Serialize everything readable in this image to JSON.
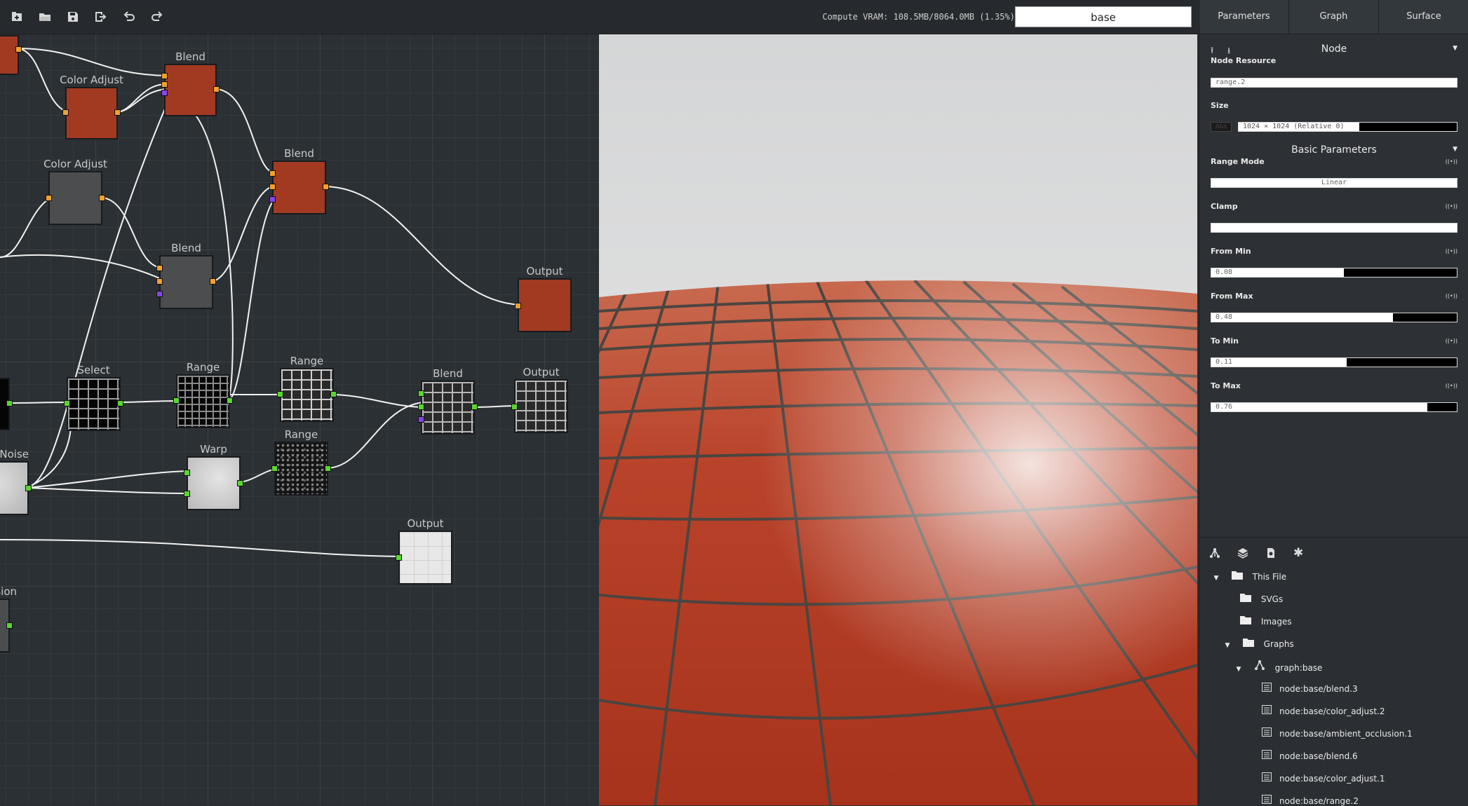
{
  "toolbar": {
    "buttons": [
      "new-file-icon",
      "open-folder-icon",
      "save-icon",
      "export-icon",
      "undo-icon",
      "redo-icon"
    ],
    "vram": "Compute VRAM: 108.5MB/8064.0MB (1.35%)",
    "graph_name": "base"
  },
  "graph": {
    "nodes": {
      "blend_a": "Blend",
      "color_adjust_a": "Color Adjust",
      "color_adjust_b": "Color Adjust",
      "blend_b": "Blend",
      "blend_c": "Blend",
      "output_a": "Output",
      "select": "Select",
      "range_a": "Range",
      "range_b": "Range",
      "blend_d": "Blend",
      "output_b": "Output",
      "noise": "Noise",
      "warp": "Warp",
      "range_c": "Range",
      "output_c": "Output",
      "occlusion": "lusion"
    }
  },
  "panel": {
    "tabs": [
      "Parameters",
      "Graph",
      "Surface"
    ],
    "node_header": "Node",
    "node_resource_label": "Node Resource",
    "node_resource_value": "range.2",
    "size_label": "Size",
    "size_abs": "Abs",
    "size_value": "1024 × 1024 (Relative 0)",
    "basic_header": "Basic Parameters",
    "params": [
      {
        "label": "Range Mode",
        "value": "Linear",
        "fraction": null
      },
      {
        "label": "Clamp",
        "value": "",
        "fraction": null
      },
      {
        "label": "From Min",
        "value": "0.08",
        "fraction": 0.54
      },
      {
        "label": "From Max",
        "value": "0.48",
        "fraction": 0.74
      },
      {
        "label": "To Min",
        "value": "0.11",
        "fraction": 0.55
      },
      {
        "label": "To Max",
        "value": "0.76",
        "fraction": 0.88
      }
    ]
  },
  "tree": {
    "tab_icons": [
      "graph-icon",
      "layers-icon",
      "file-icon",
      "asterisk-icon"
    ],
    "this_file": "This File",
    "svgs": "SVGs",
    "images": "Images",
    "graphs": "Graphs",
    "graph_base": "graph:base",
    "items": [
      "node:base/blend.3",
      "node:base/color_adjust.2",
      "node:base/ambient_occlusion.1",
      "node:base/blend.6",
      "node:base/color_adjust.1",
      "node:base/range.2"
    ]
  }
}
